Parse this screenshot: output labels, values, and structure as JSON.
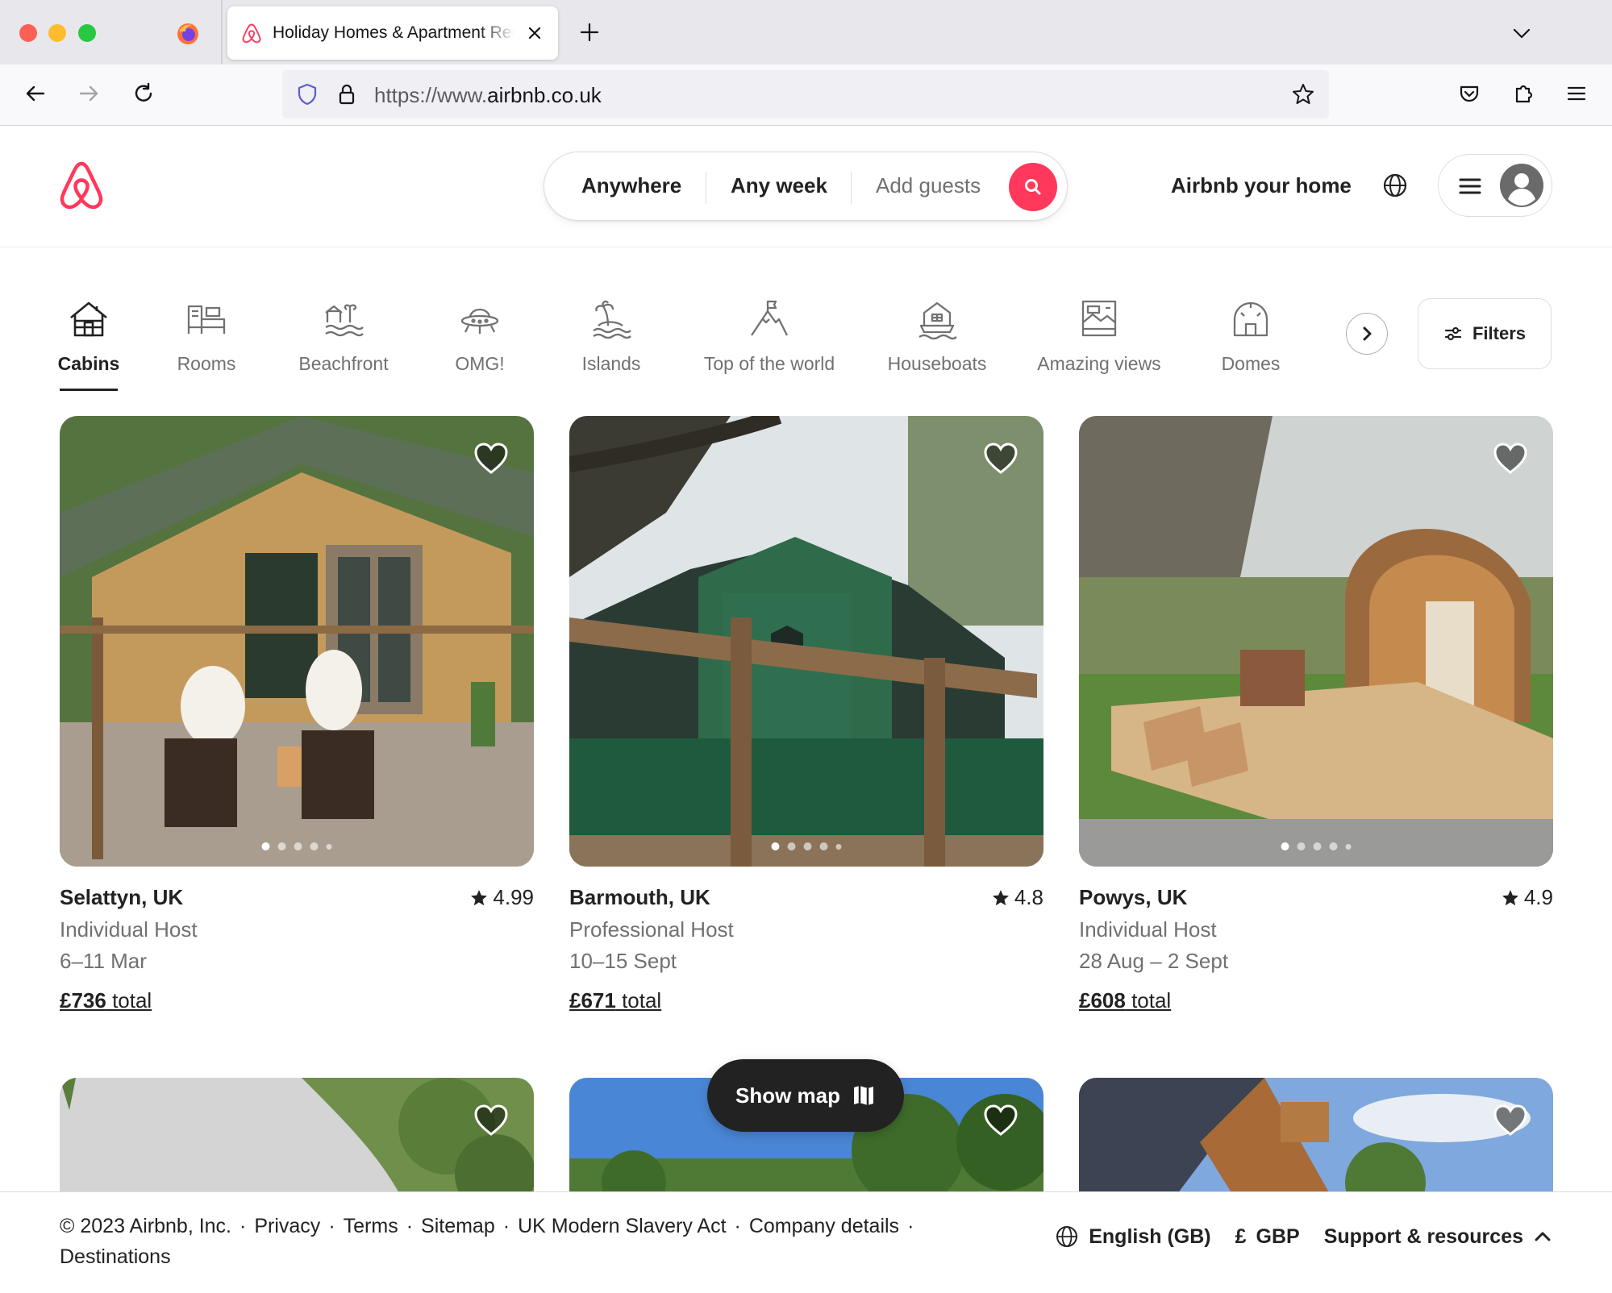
{
  "browser": {
    "tab_title": "Holiday Homes & Apartment Rentals - Airbnb",
    "url_prefix": "https://www.",
    "url_domain": "airbnb.co.uk"
  },
  "header": {
    "search": {
      "where": "Anywhere",
      "when": "Any week",
      "who_placeholder": "Add guests"
    },
    "host_link": "Airbnb your home"
  },
  "categories": [
    {
      "label": "Cabins",
      "icon": "cabin-icon",
      "active": true
    },
    {
      "label": "Rooms",
      "icon": "rooms-icon"
    },
    {
      "label": "Beachfront",
      "icon": "beachfront-icon"
    },
    {
      "label": "OMG!",
      "icon": "ufo-icon"
    },
    {
      "label": "Islands",
      "icon": "island-icon"
    },
    {
      "label": "Top of the world",
      "icon": "mountain-flag-icon"
    },
    {
      "label": "Houseboats",
      "icon": "houseboat-icon"
    },
    {
      "label": "Amazing views",
      "icon": "amazing-views-icon"
    },
    {
      "label": "Domes",
      "icon": "dome-icon"
    }
  ],
  "filters_label": "Filters",
  "listings": [
    {
      "location": "Selattyn, UK",
      "rating": "4.99",
      "host": "Individual Host",
      "dates": "6–11 Mar",
      "price": "£736",
      "price_suffix": " total"
    },
    {
      "location": "Barmouth, UK",
      "rating": "4.8",
      "host": "Professional Host",
      "dates": "10–15 Sept",
      "price": "£671",
      "price_suffix": " total"
    },
    {
      "location": "Powys, UK",
      "rating": "4.9",
      "host": "Individual Host",
      "dates": "28 Aug – 2 Sept",
      "price": "£608",
      "price_suffix": " total"
    }
  ],
  "show_map_label": "Show map",
  "footer": {
    "copyright": "© 2023 Airbnb, Inc.",
    "links": [
      "Privacy",
      "Terms",
      "Sitemap",
      "UK Modern Slavery Act",
      "Company details",
      "Destinations"
    ],
    "language": "English (GB)",
    "currency_symbol": "£",
    "currency": "GBP",
    "support": "Support & resources"
  },
  "colors": {
    "brand": "#ff385c",
    "text": "#222222",
    "muted": "#717171"
  }
}
